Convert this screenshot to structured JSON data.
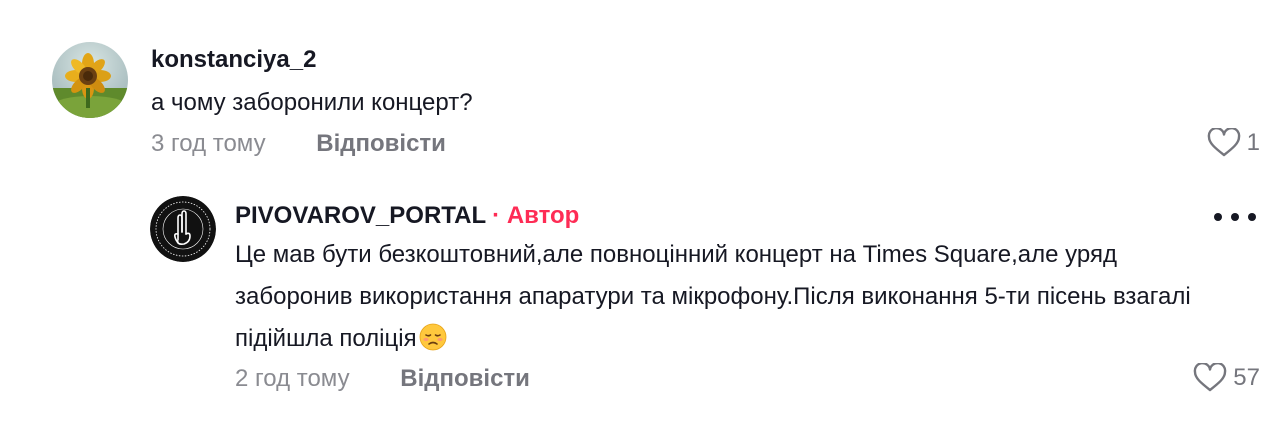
{
  "comments": [
    {
      "username": "konstanciya_2",
      "text": "а чому заборонили концерт?",
      "time": "3 год тому",
      "reply_label": "Відповісти",
      "likes": "1",
      "avatar_icon": "sunflower-avatar"
    },
    {
      "username": "PIVOVAROV_PORTAL",
      "author_tag": "· Автор",
      "text": "Це мав бути безкоштовний,але повноцінний концерт на Times Square,але уряд заборонив використання апаратури та мікрофону.Після виконання 5-ти пісень взагалі підійшла поліція",
      "emoji": "disappointed-face-emoji",
      "time": "2 год тому",
      "reply_label": "Відповісти",
      "likes": "57",
      "avatar_icon": "hand-gesture-logo"
    }
  ],
  "colors": {
    "author": "#fe2c55",
    "text": "#161823",
    "muted": "#8a8b91"
  }
}
